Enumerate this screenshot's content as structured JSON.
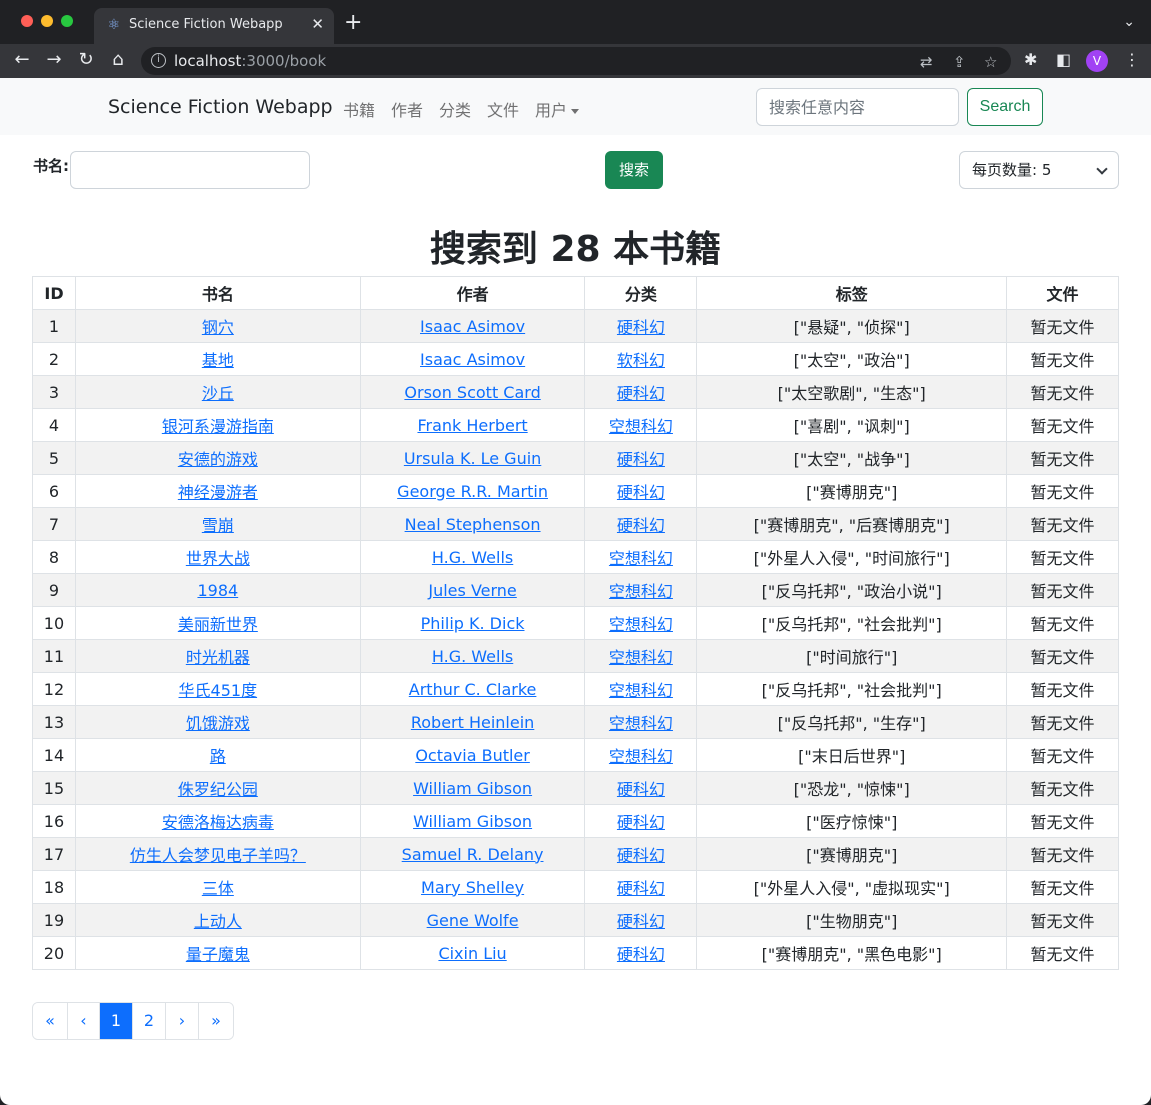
{
  "browser": {
    "tab_title": "Science Fiction Webapp",
    "url_host": "localhost",
    "url_rest": ":3000/book",
    "profile_initial": "V"
  },
  "navbar": {
    "brand": "Science Fiction Webapp",
    "links": [
      "书籍",
      "作者",
      "分类",
      "文件",
      "用户"
    ],
    "search_placeholder": "搜索任意内容",
    "search_button": "Search"
  },
  "filter": {
    "label": "书名:",
    "search_button": "搜索",
    "per_page": "每页数量: 5"
  },
  "heading": "搜索到 28 本书籍",
  "table": {
    "columns": [
      "ID",
      "书名",
      "作者",
      "分类",
      "标签",
      "文件"
    ],
    "rows": [
      {
        "id": "1",
        "title": "钢穴",
        "author": "Isaac Asimov",
        "category": "硬科幻",
        "tags": "[\"悬疑\", \"侦探\"]",
        "file": "暂无文件"
      },
      {
        "id": "2",
        "title": "基地",
        "author": "Isaac Asimov",
        "category": "软科幻",
        "tags": "[\"太空\", \"政治\"]",
        "file": "暂无文件"
      },
      {
        "id": "3",
        "title": "沙丘",
        "author": "Orson Scott Card",
        "category": "硬科幻",
        "tags": "[\"太空歌剧\", \"生态\"]",
        "file": "暂无文件"
      },
      {
        "id": "4",
        "title": "银河系漫游指南",
        "author": "Frank Herbert",
        "category": "空想科幻",
        "tags": "[\"喜剧\", \"讽刺\"]",
        "file": "暂无文件"
      },
      {
        "id": "5",
        "title": "安德的游戏",
        "author": "Ursula K. Le Guin",
        "category": "硬科幻",
        "tags": "[\"太空\", \"战争\"]",
        "file": "暂无文件"
      },
      {
        "id": "6",
        "title": "神经漫游者",
        "author": "George R.R. Martin",
        "category": "硬科幻",
        "tags": "[\"赛博朋克\"]",
        "file": "暂无文件"
      },
      {
        "id": "7",
        "title": "雪崩",
        "author": "Neal Stephenson",
        "category": "硬科幻",
        "tags": "[\"赛博朋克\", \"后赛博朋克\"]",
        "file": "暂无文件"
      },
      {
        "id": "8",
        "title": "世界大战",
        "author": "H.G. Wells",
        "category": "空想科幻",
        "tags": "[\"外星人入侵\", \"时间旅行\"]",
        "file": "暂无文件"
      },
      {
        "id": "9",
        "title": "1984",
        "author": "Jules Verne",
        "category": "空想科幻",
        "tags": "[\"反乌托邦\", \"政治小说\"]",
        "file": "暂无文件"
      },
      {
        "id": "10",
        "title": "美丽新世界",
        "author": "Philip K. Dick",
        "category": "空想科幻",
        "tags": "[\"反乌托邦\", \"社会批判\"]",
        "file": "暂无文件"
      },
      {
        "id": "11",
        "title": "时光机器",
        "author": "H.G. Wells",
        "category": "空想科幻",
        "tags": "[\"时间旅行\"]",
        "file": "暂无文件"
      },
      {
        "id": "12",
        "title": "华氏451度",
        "author": "Arthur C. Clarke",
        "category": "空想科幻",
        "tags": "[\"反乌托邦\", \"社会批判\"]",
        "file": "暂无文件"
      },
      {
        "id": "13",
        "title": "饥饿游戏",
        "author": "Robert Heinlein",
        "category": "空想科幻",
        "tags": "[\"反乌托邦\", \"生存\"]",
        "file": "暂无文件"
      },
      {
        "id": "14",
        "title": "路",
        "author": "Octavia Butler",
        "category": "空想科幻",
        "tags": "[\"末日后世界\"]",
        "file": "暂无文件"
      },
      {
        "id": "15",
        "title": "侏罗纪公园",
        "author": "William Gibson",
        "category": "硬科幻",
        "tags": "[\"恐龙\", \"惊悚\"]",
        "file": "暂无文件"
      },
      {
        "id": "16",
        "title": "安德洛梅达病毒",
        "author": "William Gibson",
        "category": "硬科幻",
        "tags": "[\"医疗惊悚\"]",
        "file": "暂无文件"
      },
      {
        "id": "17",
        "title": "仿生人会梦见电子羊吗？",
        "author": "Samuel R. Delany",
        "category": "硬科幻",
        "tags": "[\"赛博朋克\"]",
        "file": "暂无文件"
      },
      {
        "id": "18",
        "title": "三体",
        "author": "Mary Shelley",
        "category": "硬科幻",
        "tags": "[\"外星人入侵\", \"虚拟现实\"]",
        "file": "暂无文件"
      },
      {
        "id": "19",
        "title": "上动人",
        "author": "Gene Wolfe",
        "category": "硬科幻",
        "tags": "[\"生物朋克\"]",
        "file": "暂无文件"
      },
      {
        "id": "20",
        "title": "量子魔鬼",
        "author": "Cixin Liu",
        "category": "硬科幻",
        "tags": "[\"赛博朋克\", \"黑色电影\"]",
        "file": "暂无文件"
      }
    ]
  },
  "pagination": {
    "first": "«",
    "prev": "‹",
    "pages": [
      "1",
      "2"
    ],
    "current": "1",
    "next": "›",
    "last": "»"
  }
}
